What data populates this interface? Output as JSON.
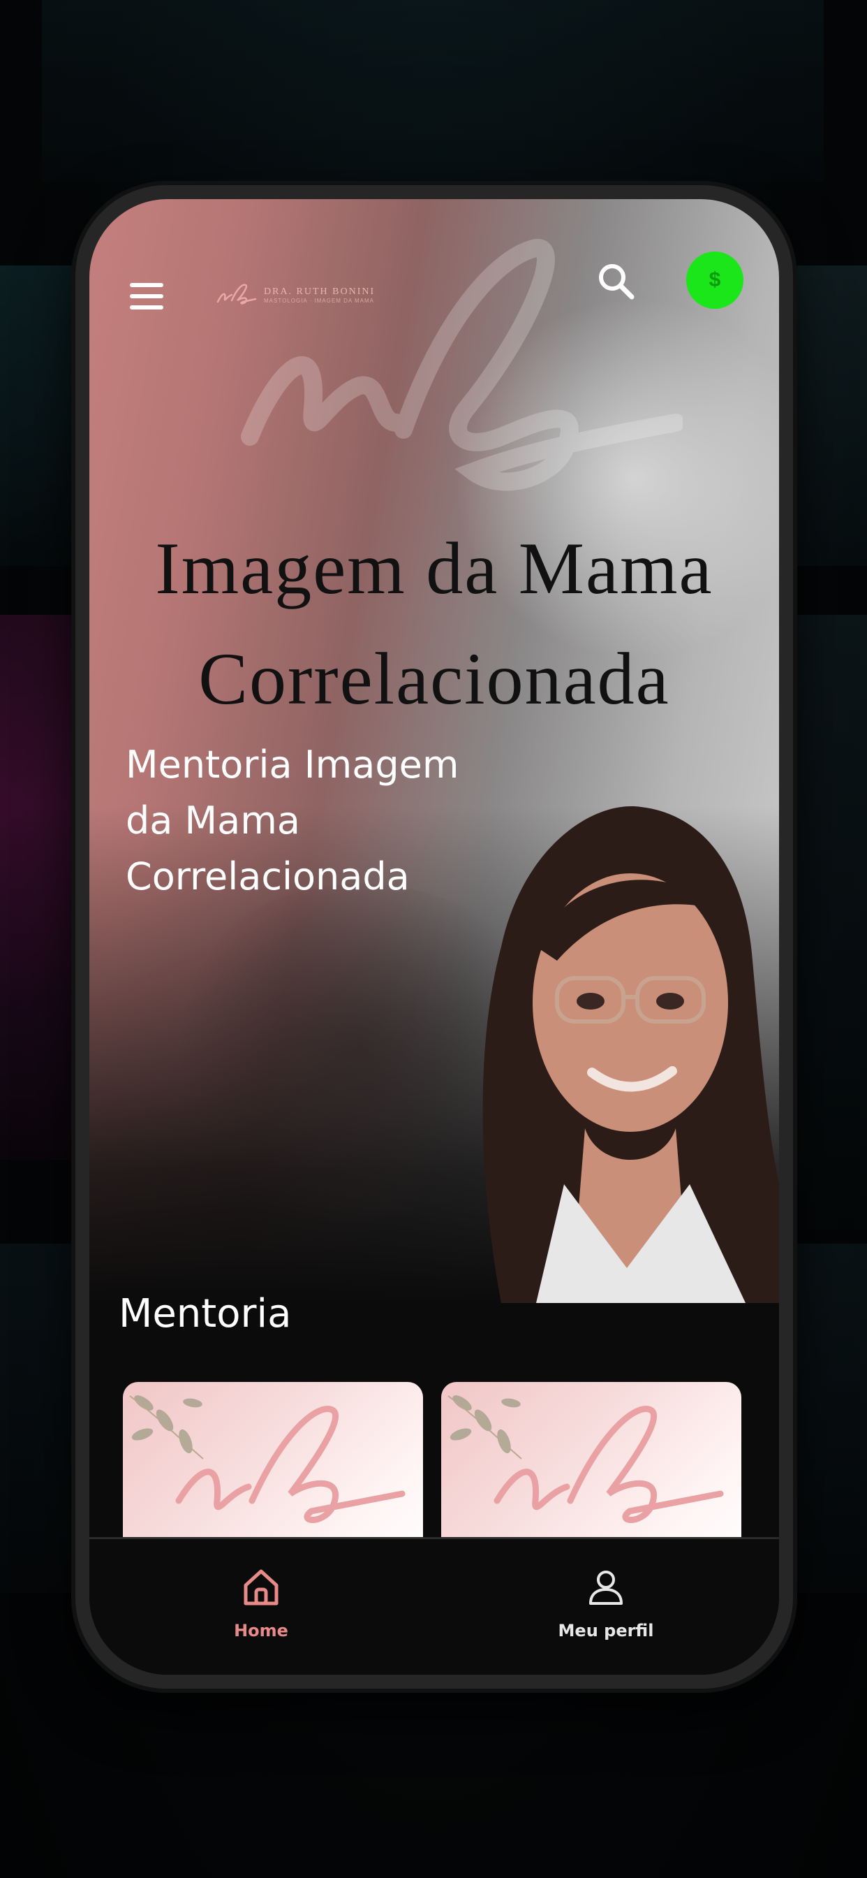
{
  "header": {
    "logo_text": "DRA. RUTH BONINI",
    "logo_subtext": "MASTOLOGIA · IMAGEM DA MAMA",
    "coin_label": "$",
    "menu_icon": "hamburger-menu-icon",
    "search_icon": "search-icon"
  },
  "hero": {
    "title_line1": "Imagem da Mama",
    "title_line2": "Correlacionada",
    "subtitle_line1": "Mentoria Imagem",
    "subtitle_line2": "da Mama",
    "subtitle_line3": "Correlacionada"
  },
  "section": {
    "title": "Mentoria",
    "cards": [
      {
        "image": "rb-monogram-floral"
      },
      {
        "image": "rb-monogram-floral"
      }
    ]
  },
  "bottom_nav": {
    "items": [
      {
        "label": "Home",
        "icon": "home-icon",
        "active": true
      },
      {
        "label": "Meu perfil",
        "icon": "user-icon",
        "active": false
      }
    ]
  },
  "colors": {
    "accent": "#e88a88",
    "coin": "#1ae61a",
    "background": "#0b0b0b"
  }
}
